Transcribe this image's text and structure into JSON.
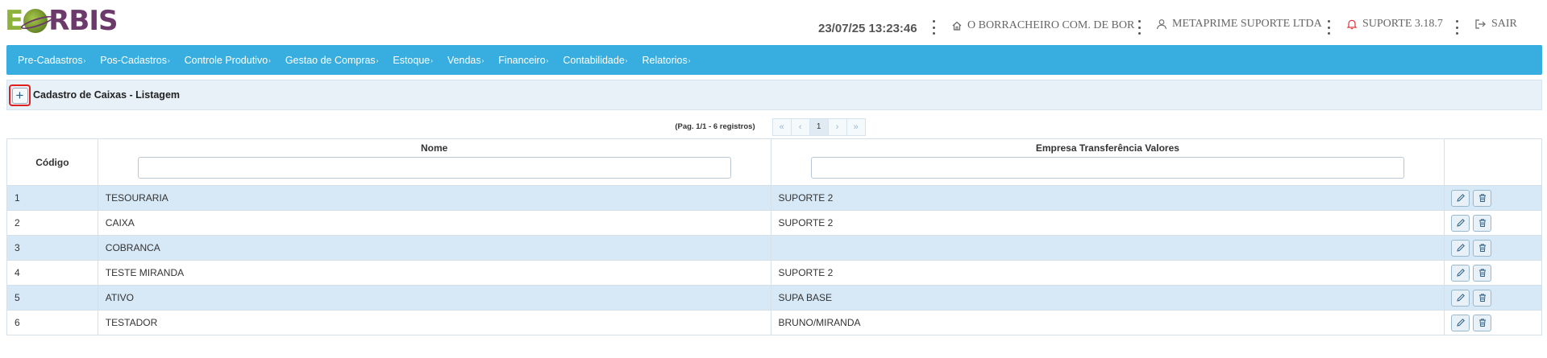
{
  "header": {
    "logo_text_e": "E",
    "logo_text_rbis": "RBIS",
    "datetime": "23/07/25 13:23:46",
    "company": "O BORRACHEIRO COM. DE BOR",
    "user": "METAPRIME SUPORTE LTDA",
    "version": "SUPORTE 3.18.7",
    "logout": "SAIR"
  },
  "menu": {
    "items": [
      {
        "label": "Pre-Cadastros"
      },
      {
        "label": "Pos-Cadastros"
      },
      {
        "label": "Controle Produtivo"
      },
      {
        "label": "Gestao de Compras"
      },
      {
        "label": "Estoque"
      },
      {
        "label": "Vendas"
      },
      {
        "label": "Financeiro"
      },
      {
        "label": "Contabilidade"
      },
      {
        "label": "Relatorios"
      }
    ]
  },
  "page": {
    "title": "Cadastro de Caixas - Listagem",
    "add_symbol": "+"
  },
  "pager": {
    "info": "(Pag. 1/1 - 6 registros)",
    "first": "«",
    "prev": "‹",
    "current": "1",
    "next": "›",
    "last": "»"
  },
  "table": {
    "columns": {
      "codigo": "Código",
      "nome": "Nome",
      "empresa": "Empresa Transferência Valores"
    },
    "rows": [
      {
        "codigo": "1",
        "nome": "TESOURARIA",
        "empresa": "SUPORTE 2"
      },
      {
        "codigo": "2",
        "nome": "CAIXA",
        "empresa": "SUPORTE 2"
      },
      {
        "codigo": "3",
        "nome": "COBRANCA",
        "empresa": ""
      },
      {
        "codigo": "4",
        "nome": "TESTE MIRANDA",
        "empresa": "SUPORTE 2"
      },
      {
        "codigo": "5",
        "nome": "ATIVO",
        "empresa": "SUPA BASE"
      },
      {
        "codigo": "6",
        "nome": "TESTADOR",
        "empresa": "BRUNO/MIRANDA"
      }
    ]
  },
  "colors": {
    "menu_bg": "#37aedf",
    "row_alt": "#d7e8f6",
    "titlebar_bg": "#e8f1f8",
    "logo_green": "#8db33a",
    "logo_purple": "#6b3a6b",
    "highlight_red": "#e02020",
    "bell_red": "#e0303a"
  }
}
